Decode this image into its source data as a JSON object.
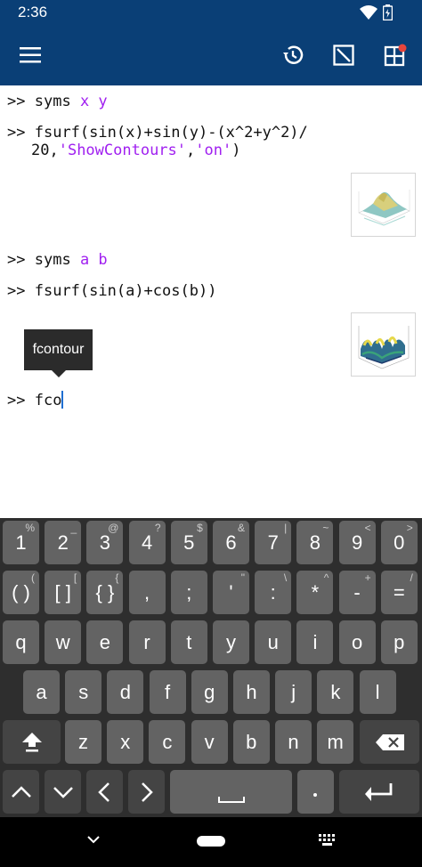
{
  "status": {
    "time": "2:36"
  },
  "console": {
    "prompt": ">>",
    "lines": [
      {
        "cmd": "syms",
        "args": "x y"
      },
      {
        "text1": "fsurf(sin(x)+sin(y)-(x^2+y^2)/",
        "text2a": "20,",
        "str1": "'ShowContours'",
        "comma": ",",
        "str2": "'on'",
        "close": ")"
      },
      {
        "cmd": "syms",
        "args": "a b"
      },
      {
        "text1": "fsurf(sin(a)+cos(b))"
      },
      {
        "input": "fco"
      }
    ],
    "tooltip": "fcontour"
  },
  "keyboard": {
    "row1": [
      {
        "main": "1",
        "hint": "%"
      },
      {
        "main": "2",
        "hint": "_"
      },
      {
        "main": "3",
        "hint": "@"
      },
      {
        "main": "4",
        "hint": "?"
      },
      {
        "main": "5",
        "hint": "$"
      },
      {
        "main": "6",
        "hint": "&"
      },
      {
        "main": "7",
        "hint": "|"
      },
      {
        "main": "8",
        "hint": "~"
      },
      {
        "main": "9",
        "hint": "<"
      },
      {
        "main": "0",
        "hint": ">"
      }
    ],
    "row2": [
      {
        "main": "( )",
        "hint": "("
      },
      {
        "main": "[ ]",
        "hint": "["
      },
      {
        "main": "{ }",
        "hint": "{"
      },
      {
        "main": ",",
        "hint": ""
      },
      {
        "main": ";",
        "hint": ""
      },
      {
        "main": "'",
        "hint": "\""
      },
      {
        "main": ":",
        "hint": "\\"
      },
      {
        "main": "*",
        "hint": "^"
      },
      {
        "main": "-",
        "hint": "+"
      },
      {
        "main": "=",
        "hint": "/"
      }
    ],
    "row3": [
      "q",
      "w",
      "e",
      "r",
      "t",
      "y",
      "u",
      "i",
      "o",
      "p"
    ],
    "row4": [
      "a",
      "s",
      "d",
      "f",
      "g",
      "h",
      "j",
      "k",
      "l"
    ],
    "row5": [
      "z",
      "x",
      "c",
      "v",
      "b",
      "n",
      "m"
    ]
  }
}
